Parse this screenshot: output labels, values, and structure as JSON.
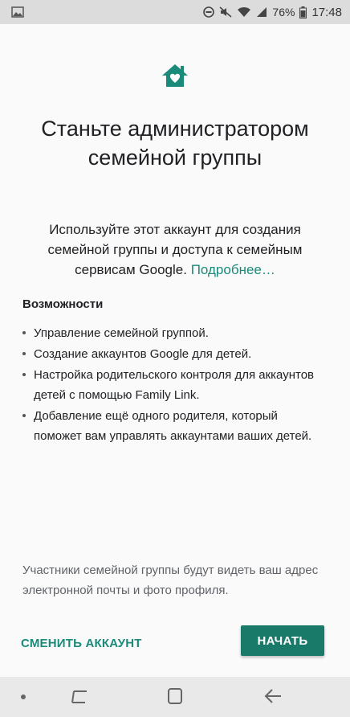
{
  "status_bar": {
    "battery": "76%",
    "time": "17:48",
    "icons": [
      "gallery-icon",
      "do-not-disturb-icon",
      "mute-icon",
      "wifi-icon",
      "signal-icon",
      "battery-icon"
    ]
  },
  "header": {
    "icon": "family-home-heart-icon",
    "title_line1": "Станьте администратором",
    "title_line2": "семейной группы"
  },
  "intro": {
    "text": "Используйте этот аккаунт для создания семейной группы и доступа к семейным сервисам Google.",
    "link": "Подробнее…"
  },
  "features": {
    "heading": "Возможности",
    "items": [
      "Управление семейной группой.",
      "Создание аккаунтов Google для детей.",
      "Настройка родительского контроля для аккаунтов детей с помощью Family Link.",
      "Добавление ещё одного родителя, который поможет вам управлять аккаунтами ваших детей."
    ]
  },
  "note": "Участники семейной группы будут видеть ваш адрес электронной почты и фото профиля.",
  "actions": {
    "switch_account": "СМЕНИТЬ АККАУНТ",
    "start": "НАЧАТЬ"
  },
  "nav_bar": {
    "icons": [
      "dot-icon",
      "recents-icon",
      "home-icon",
      "back-icon"
    ]
  },
  "colors": {
    "accent": "#1a8a7a",
    "button_bg": "#197a69",
    "status_bar_bg": "#dcdcdc",
    "nav_bar_bg": "#e9e9e9"
  }
}
